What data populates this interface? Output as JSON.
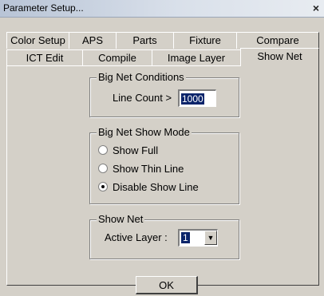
{
  "window": {
    "title": "Parameter Setup...",
    "close_label": "×"
  },
  "tabs": {
    "row1": [
      "Color Setup",
      "APS",
      "Parts",
      "Fixture",
      "Compare"
    ],
    "row2": [
      "ICT Edit",
      "Compile",
      "Image Layer",
      "Show Net"
    ],
    "active": "Show Net"
  },
  "big_net_conditions": {
    "group_label": "Big Net Conditions",
    "line_count_label": "Line Count >",
    "line_count_value": "1000"
  },
  "big_net_show_mode": {
    "group_label": "Big Net Show Mode",
    "options": [
      {
        "label": "Show Full",
        "checked": false
      },
      {
        "label": "Show Thin Line",
        "checked": false
      },
      {
        "label": "Disable Show Line",
        "checked": true
      }
    ]
  },
  "show_net": {
    "group_label": "Show Net",
    "active_layer_label": "Active Layer :",
    "active_layer_value": "1"
  },
  "buttons": {
    "ok_label": "OK"
  },
  "colors": {
    "dialog_bg": "#d4d0c8",
    "selection_bg": "#0a246a"
  }
}
